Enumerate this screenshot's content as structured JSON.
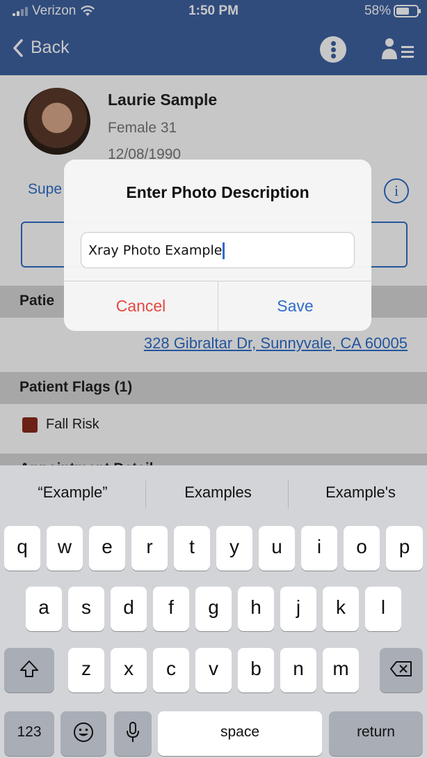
{
  "status_bar": {
    "carrier": "Verizon",
    "time": "1:50 PM",
    "battery": "58%"
  },
  "nav": {
    "back_label": "Back",
    "info_icon": "more-options-icon",
    "menu_icon": "person-menu-icon"
  },
  "patient": {
    "name": "Laurie Sample",
    "gender_age": "Female 31",
    "dob": "12/08/1990",
    "sup_link": "Supe",
    "address": "328 Gibraltar Dr, Sunnyvale, CA 60005"
  },
  "sections": {
    "patient_info": "Patie",
    "flags_title": "Patient Flags (1)",
    "flag_item": "Fall Risk",
    "flag_color": "#8a2a1c",
    "appointment": "Appointment Detail"
  },
  "dialog": {
    "title": "Enter Photo Description",
    "input_value": "Xray Photo Example",
    "cancel_label": "Cancel",
    "save_label": "Save"
  },
  "keyboard": {
    "suggestions": [
      "“Example”",
      "Examples",
      "Example's"
    ],
    "row1": [
      "q",
      "w",
      "e",
      "r",
      "t",
      "y",
      "u",
      "i",
      "o",
      "p"
    ],
    "row2": [
      "a",
      "s",
      "d",
      "f",
      "g",
      "h",
      "j",
      "k",
      "l"
    ],
    "row3": [
      "z",
      "x",
      "c",
      "v",
      "b",
      "n",
      "m"
    ],
    "numbers_key": "123",
    "space_key": "space",
    "return_key": "return"
  },
  "colors": {
    "nav_bar": "#3e62a1",
    "link": "#2f6dc8",
    "cancel": "#e5483f"
  }
}
